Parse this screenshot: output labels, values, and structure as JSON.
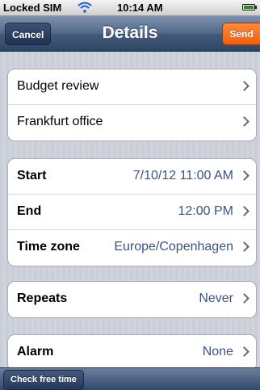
{
  "status_bar": {
    "carrier": "Locked SIM",
    "time": "10:14 AM"
  },
  "nav_bar": {
    "title": "Details",
    "cancel_label": "Cancel",
    "send_label": "Send"
  },
  "groups": {
    "event": [
      {
        "label": "Budget review"
      },
      {
        "label": "Frankfurt office"
      }
    ],
    "timing": [
      {
        "label": "Start",
        "value": "7/10/12 11:00 AM"
      },
      {
        "label": "End",
        "value": "12:00 PM"
      },
      {
        "label": "Time zone",
        "value": "Europe/Copenhagen"
      }
    ],
    "repeats": {
      "label": "Repeats",
      "value": "Never"
    },
    "alarm": {
      "label": "Alarm",
      "value": "None"
    }
  },
  "toolbar": {
    "check_free_time_label": "Check free time"
  },
  "colors": {
    "send_button": "#f05d0e",
    "value_text": "#385487",
    "nav_bar": "#455b7d"
  },
  "icons": [
    "wifi-icon",
    "battery-icon",
    "chevron-right-icon"
  ]
}
